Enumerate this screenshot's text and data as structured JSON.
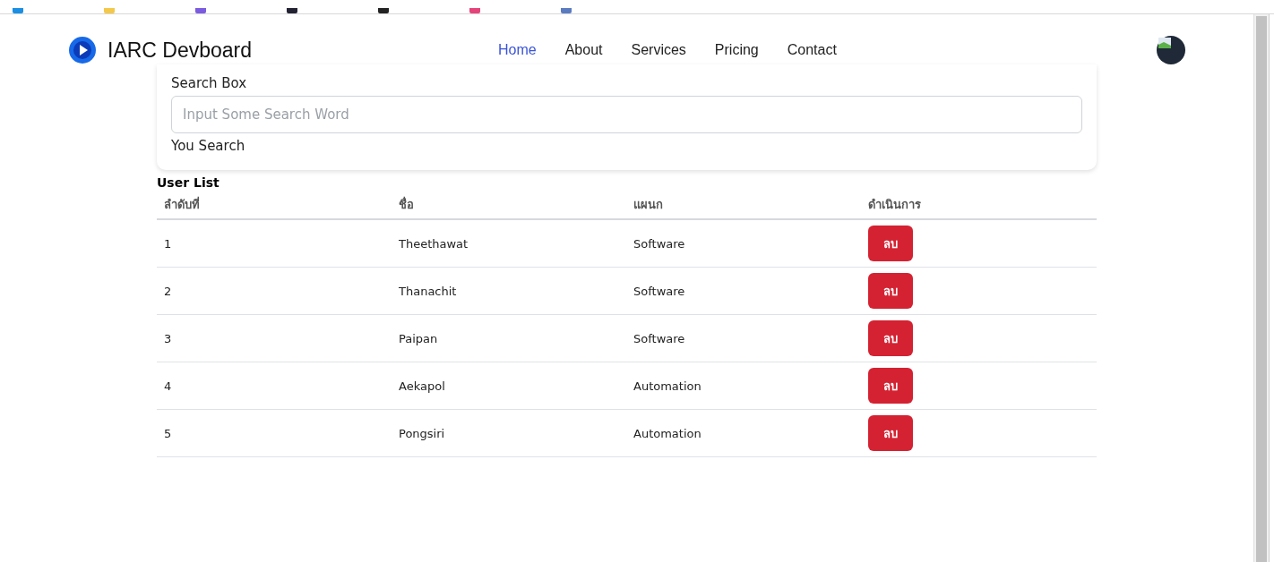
{
  "brand": {
    "name": "IARC Devboard"
  },
  "nav": [
    {
      "label": "Home",
      "selected": true
    },
    {
      "label": "About",
      "selected": false
    },
    {
      "label": "Services",
      "selected": false
    },
    {
      "label": "Pricing",
      "selected": false
    },
    {
      "label": "Contact",
      "selected": false
    }
  ],
  "search": {
    "label": "Search Box",
    "placeholder": "Input Some Search Word",
    "result_label": "You Search"
  },
  "table": {
    "title": "User List",
    "columns": [
      "ลำดับที่",
      "ชื่อ",
      "แผนก",
      "ดำเนินการ"
    ],
    "rows": [
      {
        "cells": [
          "1",
          "Theethawat",
          "Software"
        ],
        "action": "ลบ"
      },
      {
        "cells": [
          "2",
          "Thanachit",
          "Software"
        ],
        "action": "ลบ"
      },
      {
        "cells": [
          "3",
          "Paipan",
          "Software"
        ],
        "action": "ลบ"
      },
      {
        "cells": [
          "4",
          "Aekapol",
          "Automation"
        ],
        "action": "ลบ"
      },
      {
        "cells": [
          "5",
          "Pongsiri",
          "Automation"
        ],
        "action": "ลบ"
      }
    ]
  }
}
